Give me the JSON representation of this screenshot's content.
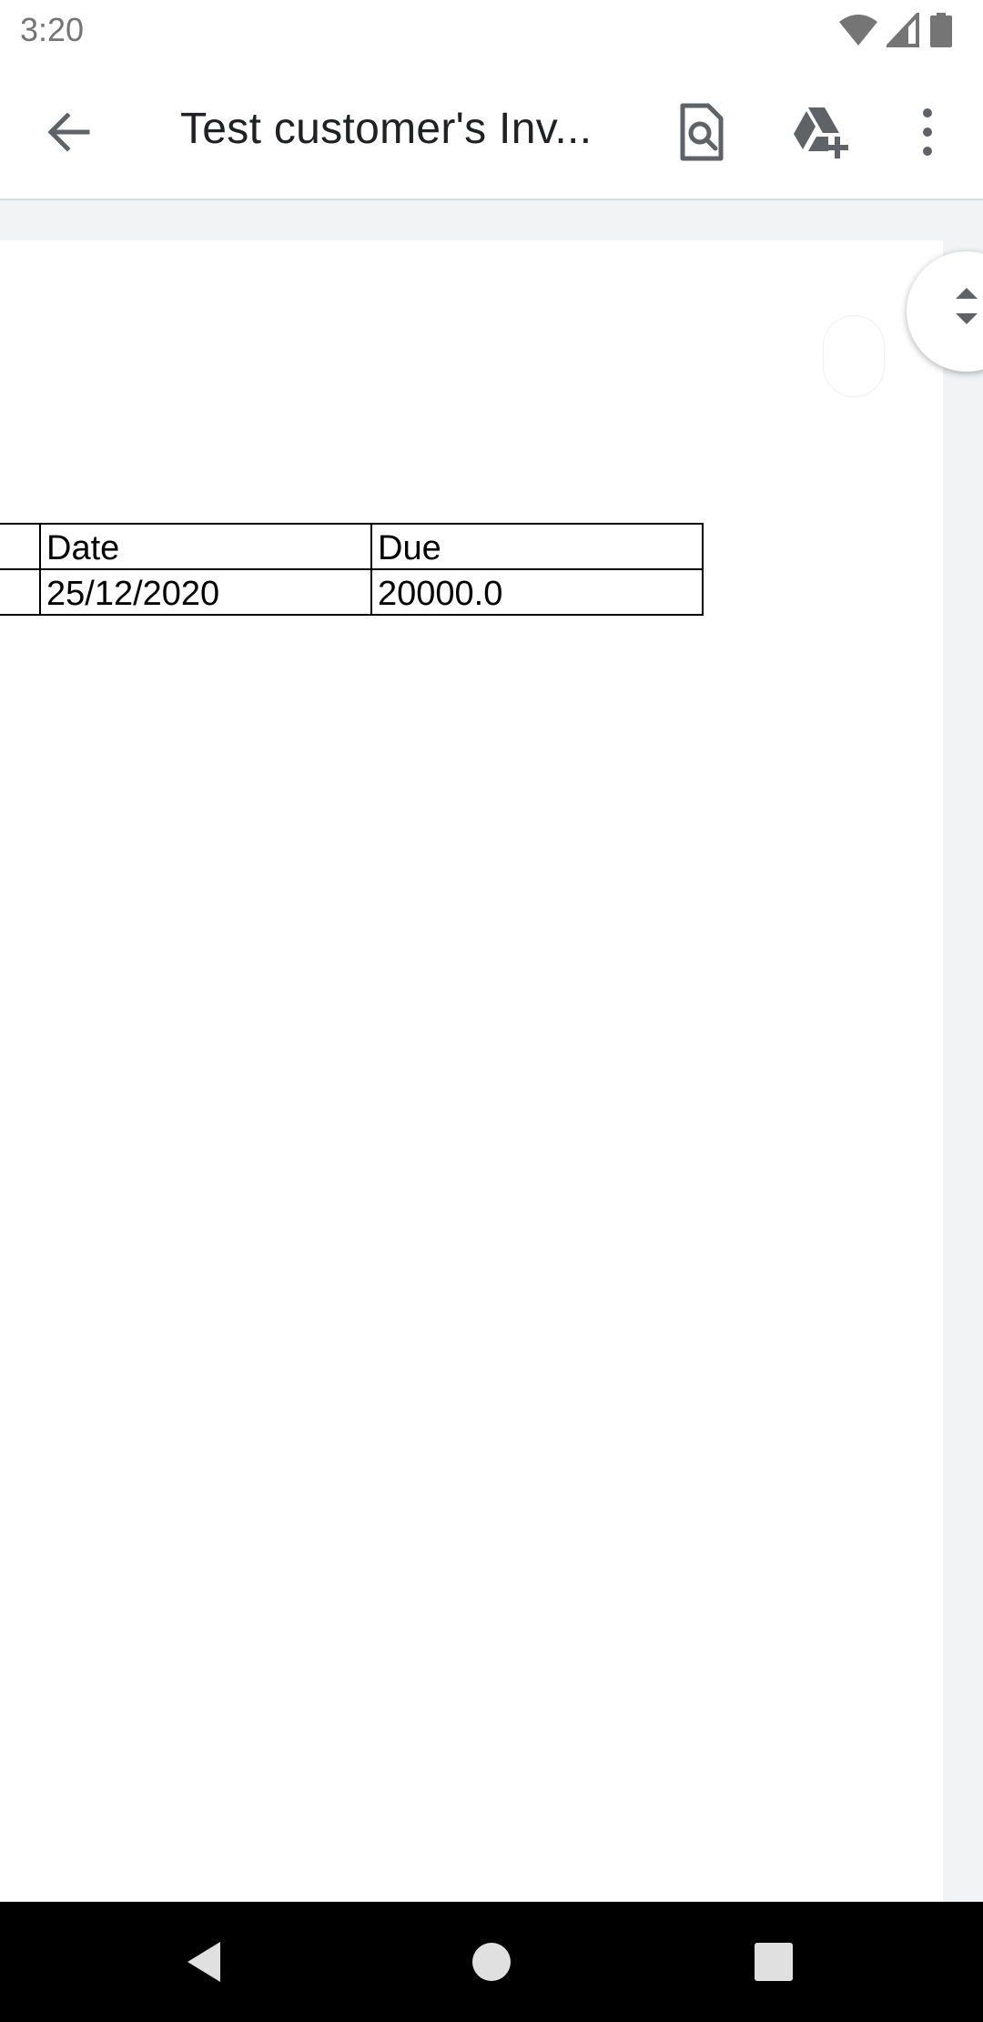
{
  "status_bar": {
    "time": "3:20",
    "icons": [
      "wifi-icon",
      "cellular-signal-icon",
      "battery-icon"
    ]
  },
  "app_bar": {
    "title": "Test customer's Inv...",
    "icons": {
      "back": "arrow-back-icon",
      "find": "find-in-page-icon",
      "drive": "add-to-drive-icon",
      "more": "more-vert-icon"
    }
  },
  "document": {
    "table": {
      "headers": [
        "",
        "Date",
        "Due"
      ],
      "rows": [
        [
          "",
          "25/12/2020",
          "20000.0"
        ]
      ]
    }
  },
  "nav_bar": {
    "icons": [
      "nav-back-icon",
      "nav-home-icon",
      "nav-recents-icon"
    ]
  },
  "colors": {
    "app_bar_bg": "#ffffff",
    "doc_bg": "#f1f3f4",
    "icon_gray": "#5f6368",
    "nav_bar_bg": "#000000"
  }
}
